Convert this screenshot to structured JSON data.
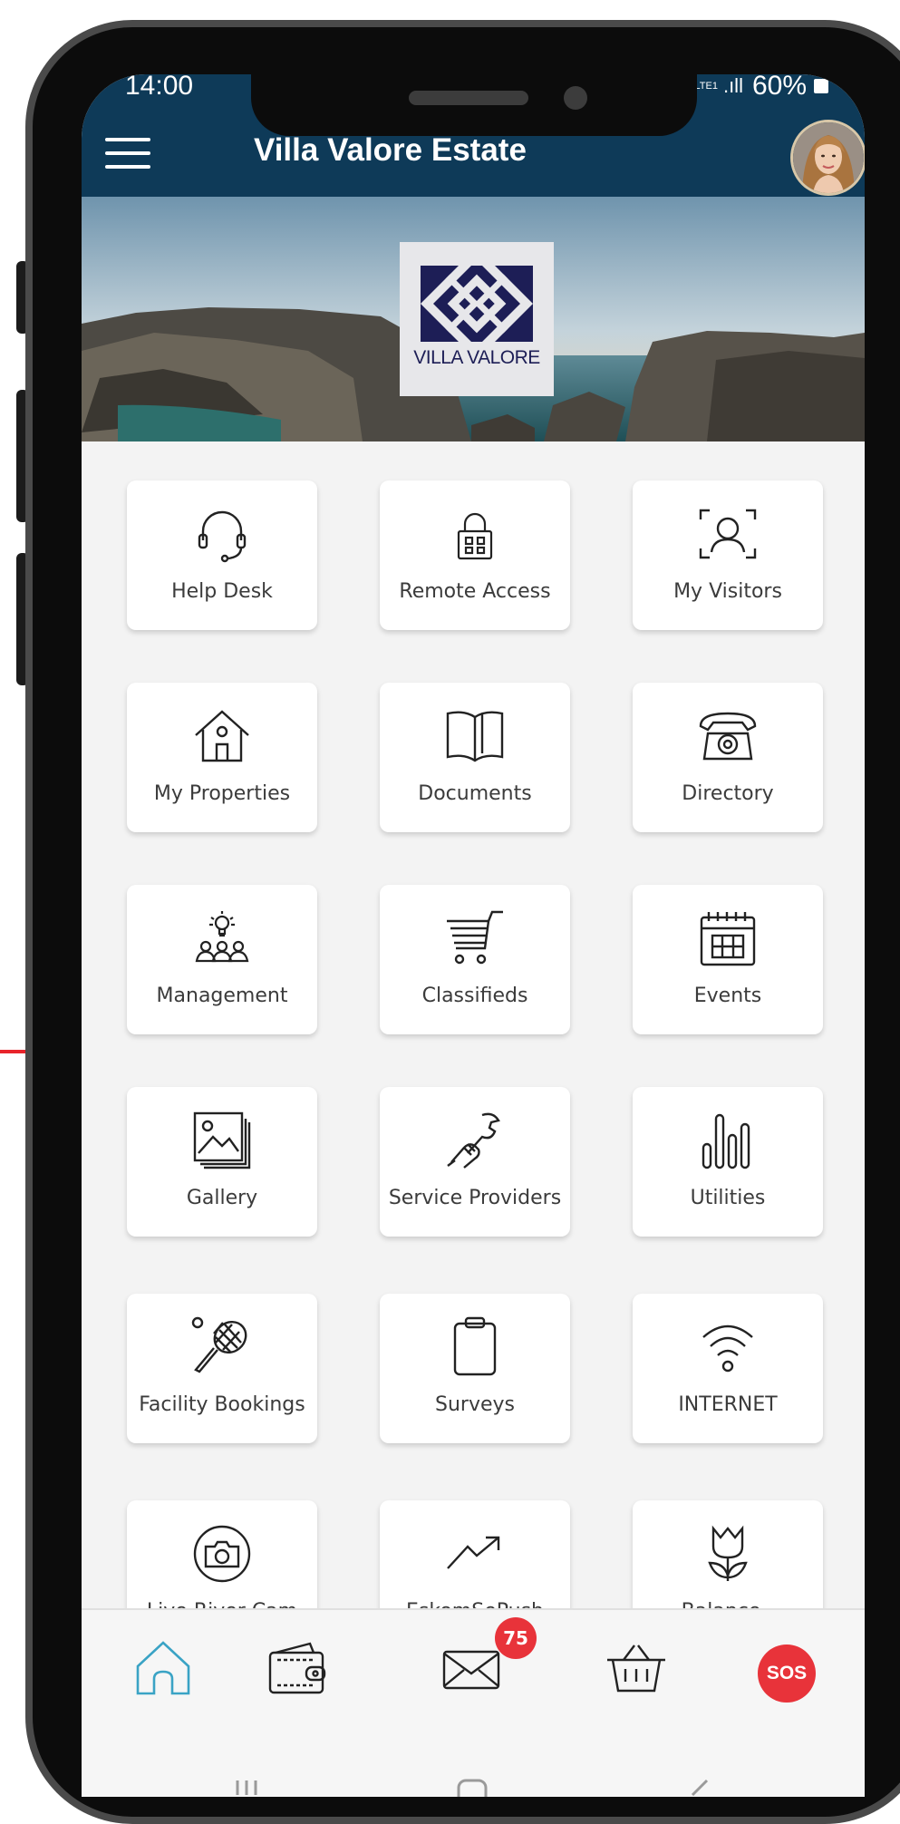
{
  "status_bar": {
    "time": "14:00",
    "network": "LTE1",
    "battery": "60%"
  },
  "header": {
    "title": "Villa Valore Estate"
  },
  "banner": {
    "logo_text": "VILLA VALORE"
  },
  "tiles": [
    {
      "label": "Help Desk"
    },
    {
      "label": "Remote Access"
    },
    {
      "label": "My Visitors"
    },
    {
      "label": "My Properties"
    },
    {
      "label": "Documents"
    },
    {
      "label": "Directory"
    },
    {
      "label": "Management"
    },
    {
      "label": "Classifieds"
    },
    {
      "label": "Events"
    },
    {
      "label": "Gallery"
    },
    {
      "label": "Service Providers"
    },
    {
      "label": "Utilities"
    },
    {
      "label": "Facility Bookings"
    },
    {
      "label": "Surveys"
    },
    {
      "label": "INTERNET"
    },
    {
      "label": "Live River Cam"
    },
    {
      "label": "EskomSePush"
    },
    {
      "label": "Balance -"
    }
  ],
  "bottom_nav": {
    "messages_badge": "75",
    "sos_label": "SOS"
  },
  "colors": {
    "header": "#0e3a58",
    "icon": "#3aa3c5",
    "badge": "#e8333a",
    "divider": "#e8242b"
  }
}
